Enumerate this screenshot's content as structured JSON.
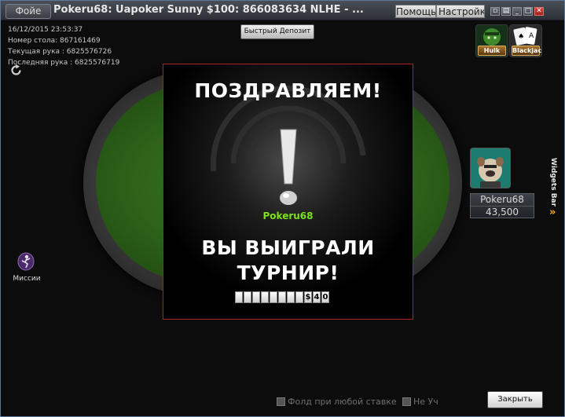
{
  "titlebar": {
    "lobby_tab": "Фойе",
    "title": "Pokeru68: Uapoker Sunny $100: 866083634 NLHE - ...",
    "menu_help": "Помощь",
    "menu_settings": "Настройки"
  },
  "table_info": {
    "datetime": "16/12/2015 23:53:37",
    "table_number": "Номер стола: 867161469",
    "current_hand": "Текущая рука : 6825576726",
    "last_hand": "Последняя рука : 6825576719"
  },
  "deposit_button": "Быстрый Депозит",
  "games": [
    {
      "label": "Hulk",
      "icon": "hulk-game-icon"
    },
    {
      "label": "Blackjack",
      "icon": "blackjack-game-icon"
    }
  ],
  "widgets_bar": {
    "label": "Widgets Bar",
    "arrow": "»"
  },
  "missions": {
    "label": "Миссии"
  },
  "player": {
    "name": "Pokeru68",
    "stack": "43,500"
  },
  "popup": {
    "title": "ПОЗДРАВЛЯЕМ!",
    "winner": "Pokeru68",
    "message_line1": "ВЫ ВЫИГРАЛИ",
    "message_line2": "ТУРНИР!",
    "prize_cells": [
      "",
      "",
      "",
      "",
      "",
      "",
      "",
      "",
      "$",
      "4",
      "0"
    ]
  },
  "options": {
    "fold_any_bet": "Фолд при любой ставке",
    "sit_out": "Не Уч"
  },
  "close_button": "Закрыть",
  "colors": {
    "felt": "#2e6319",
    "winner_name": "#7ee01a",
    "popup_border": "#b02020",
    "accent_arrow": "#f0b020"
  }
}
